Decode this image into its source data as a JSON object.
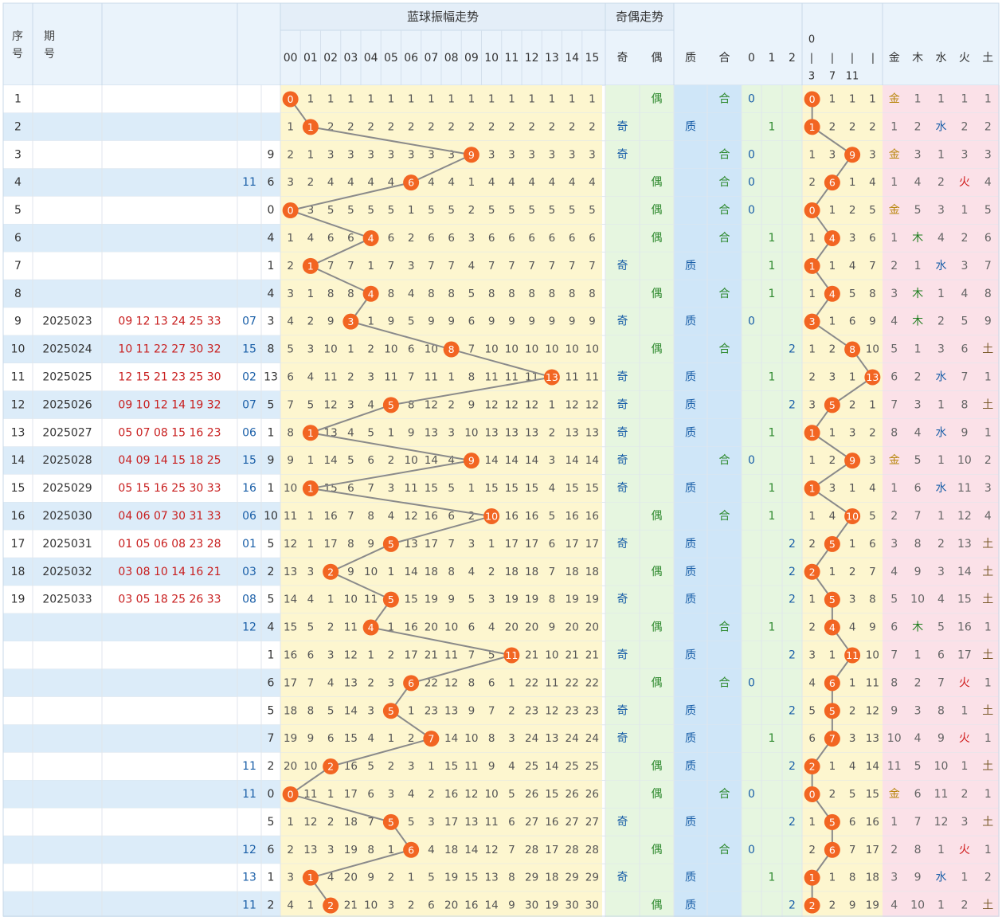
{
  "header": {
    "seq_label": "序号",
    "period_label": "期号",
    "amp_title": "蓝球振幅走势",
    "parity_title": "奇偶走势",
    "amp_cols": [
      "00",
      "01",
      "02",
      "03",
      "04",
      "05",
      "06",
      "07",
      "08",
      "09",
      "10",
      "11",
      "12",
      "13",
      "14",
      "15"
    ],
    "odd": "奇",
    "even": "偶",
    "prime": "质",
    "composite": "合",
    "r0": "0",
    "r1": "1",
    "r2": "2",
    "seg_0_3": "0|3",
    "seg_4_7": "|7",
    "seg_8_11": "|11",
    "seg_12_15": "|",
    "elements": [
      "金",
      "木",
      "水",
      "火",
      "土"
    ]
  },
  "rows": [
    {
      "seq": "1",
      "period": "",
      "reds": "",
      "blue": "",
      "val": "",
      "amp": 0,
      "amp_cells": [
        0,
        1,
        1,
        1,
        1,
        1,
        1,
        1,
        1,
        1,
        1,
        1,
        1,
        1,
        1,
        1
      ],
      "odd": "",
      "even": "偶",
      "prime": "",
      "comp": "合",
      "r0": "0",
      "r1": "",
      "r2": "",
      "seg": [
        "0",
        "1",
        "1",
        "1"
      ],
      "elem": [
        "金",
        "1",
        "1",
        "1",
        "1"
      ]
    },
    {
      "seq": "2",
      "period": "",
      "reds": "",
      "blue": "",
      "val": "",
      "amp": 1,
      "amp_cells": [
        1,
        1,
        2,
        2,
        2,
        2,
        2,
        2,
        2,
        2,
        2,
        2,
        2,
        2,
        2,
        2
      ],
      "odd": "奇",
      "even": "",
      "prime": "质",
      "comp": "",
      "r0": "",
      "r1": "1",
      "r2": "",
      "seg": [
        "1",
        "2",
        "2",
        "2"
      ],
      "elem": [
        "1",
        "2",
        "水",
        "2",
        "2"
      ]
    },
    {
      "seq": "3",
      "period": "",
      "reds": "",
      "blue": "",
      "val": "9",
      "amp": 9,
      "amp_cells": [
        2,
        1,
        3,
        3,
        3,
        3,
        3,
        3,
        3,
        9,
        3,
        3,
        3,
        3,
        3,
        3
      ],
      "odd": "奇",
      "even": "",
      "prime": "",
      "comp": "合",
      "r0": "0",
      "r1": "",
      "r2": "",
      "seg": [
        "1",
        "3",
        "9",
        "3"
      ],
      "elem": [
        "金",
        "3",
        "1",
        "3",
        "3"
      ]
    },
    {
      "seq": "4",
      "period": "",
      "reds": "",
      "blue": "11",
      "val": "6",
      "amp": 6,
      "amp_cells": [
        3,
        2,
        4,
        4,
        4,
        4,
        6,
        4,
        4,
        1,
        4,
        4,
        4,
        4,
        4,
        4
      ],
      "odd": "",
      "even": "偶",
      "prime": "",
      "comp": "合",
      "r0": "0",
      "r1": "",
      "r2": "",
      "seg": [
        "2",
        "6",
        "1",
        "4"
      ],
      "elem": [
        "1",
        "4",
        "2",
        "火",
        "4"
      ]
    },
    {
      "seq": "5",
      "period": "",
      "reds": "",
      "blue": "",
      "val": "0",
      "amp": 0,
      "amp_cells": [
        0,
        3,
        5,
        5,
        5,
        5,
        1,
        5,
        5,
        2,
        5,
        5,
        5,
        5,
        5,
        5
      ],
      "odd": "",
      "even": "偶",
      "prime": "",
      "comp": "合",
      "r0": "0",
      "r1": "",
      "r2": "",
      "seg": [
        "0",
        "1",
        "2",
        "5"
      ],
      "elem": [
        "金",
        "5",
        "3",
        "1",
        "5"
      ]
    },
    {
      "seq": "6",
      "period": "",
      "reds": "",
      "blue": "",
      "val": "4",
      "amp": 4,
      "amp_cells": [
        1,
        4,
        6,
        6,
        4,
        6,
        2,
        6,
        6,
        3,
        6,
        6,
        6,
        6,
        6,
        6
      ],
      "odd": "",
      "even": "偶",
      "prime": "",
      "comp": "合",
      "r0": "",
      "r1": "1",
      "r2": "",
      "seg": [
        "1",
        "4",
        "3",
        "6"
      ],
      "elem": [
        "1",
        "木",
        "4",
        "2",
        "6"
      ]
    },
    {
      "seq": "7",
      "period": "",
      "reds": "",
      "blue": "",
      "val": "1",
      "amp": 1,
      "amp_cells": [
        2,
        1,
        7,
        7,
        1,
        7,
        3,
        7,
        7,
        4,
        7,
        7,
        7,
        7,
        7,
        7
      ],
      "odd": "奇",
      "even": "",
      "prime": "质",
      "comp": "",
      "r0": "",
      "r1": "1",
      "r2": "",
      "seg": [
        "1",
        "1",
        "4",
        "7"
      ],
      "elem": [
        "2",
        "1",
        "水",
        "3",
        "7"
      ]
    },
    {
      "seq": "8",
      "period": "",
      "reds": "",
      "blue": "",
      "val": "4",
      "amp": 4,
      "amp_cells": [
        3,
        1,
        8,
        8,
        4,
        8,
        4,
        8,
        8,
        5,
        8,
        8,
        8,
        8,
        8,
        8
      ],
      "odd": "",
      "even": "偶",
      "prime": "",
      "comp": "合",
      "r0": "",
      "r1": "1",
      "r2": "",
      "seg": [
        "1",
        "4",
        "5",
        "8"
      ],
      "elem": [
        "3",
        "木",
        "1",
        "4",
        "8"
      ]
    },
    {
      "seq": "9",
      "period": "2025023",
      "reds": "09 12 13 24 25 33",
      "blue": "07",
      "val": "3",
      "amp": 3,
      "amp_cells": [
        4,
        2,
        9,
        3,
        1,
        9,
        5,
        9,
        9,
        6,
        9,
        9,
        9,
        9,
        9,
        9
      ],
      "odd": "奇",
      "even": "",
      "prime": "质",
      "comp": "",
      "r0": "0",
      "r1": "",
      "r2": "",
      "seg": [
        "3",
        "1",
        "6",
        "9"
      ],
      "elem": [
        "4",
        "木",
        "2",
        "5",
        "9"
      ]
    },
    {
      "seq": "10",
      "period": "2025024",
      "reds": "10 11 22 27 30 32",
      "blue": "15",
      "val": "8",
      "amp": 8,
      "amp_cells": [
        5,
        3,
        10,
        1,
        2,
        10,
        6,
        10,
        8,
        7,
        10,
        10,
        10,
        10,
        10,
        10
      ],
      "odd": "",
      "even": "偶",
      "prime": "",
      "comp": "合",
      "r0": "",
      "r1": "",
      "r2": "2",
      "seg": [
        "1",
        "2",
        "8",
        "10"
      ],
      "elem": [
        "5",
        "1",
        "3",
        "6",
        "土"
      ]
    },
    {
      "seq": "11",
      "period": "2025025",
      "reds": "12 15 21 23 25 30",
      "blue": "02",
      "val": "13",
      "amp": 13,
      "amp_cells": [
        6,
        4,
        11,
        2,
        3,
        11,
        7,
        11,
        1,
        8,
        11,
        11,
        11,
        13,
        11,
        11
      ],
      "odd": "奇",
      "even": "",
      "prime": "质",
      "comp": "",
      "r0": "",
      "r1": "1",
      "r2": "",
      "seg": [
        "2",
        "3",
        "1",
        "13"
      ],
      "elem": [
        "6",
        "2",
        "水",
        "7",
        "1"
      ]
    },
    {
      "seq": "12",
      "period": "2025026",
      "reds": "09 10 12 14 19 32",
      "blue": "07",
      "val": "5",
      "amp": 5,
      "amp_cells": [
        7,
        5,
        12,
        3,
        4,
        5,
        8,
        12,
        2,
        9,
        12,
        12,
        12,
        1,
        12,
        12
      ],
      "odd": "奇",
      "even": "",
      "prime": "质",
      "comp": "",
      "r0": "",
      "r1": "",
      "r2": "2",
      "seg": [
        "3",
        "5",
        "2",
        "1"
      ],
      "elem": [
        "7",
        "3",
        "1",
        "8",
        "土"
      ]
    },
    {
      "seq": "13",
      "period": "2025027",
      "reds": "05 07 08 15 16 23",
      "blue": "06",
      "val": "1",
      "amp": 1,
      "amp_cells": [
        8,
        1,
        13,
        4,
        5,
        1,
        9,
        13,
        3,
        10,
        13,
        13,
        13,
        2,
        13,
        13
      ],
      "odd": "奇",
      "even": "",
      "prime": "质",
      "comp": "",
      "r0": "",
      "r1": "1",
      "r2": "",
      "seg": [
        "1",
        "1",
        "3",
        "2"
      ],
      "elem": [
        "8",
        "4",
        "水",
        "9",
        "1"
      ]
    },
    {
      "seq": "14",
      "period": "2025028",
      "reds": "04 09 14 15 18 25",
      "blue": "15",
      "val": "9",
      "amp": 9,
      "amp_cells": [
        9,
        1,
        14,
        5,
        6,
        2,
        10,
        14,
        4,
        9,
        14,
        14,
        14,
        3,
        14,
        14
      ],
      "odd": "奇",
      "even": "",
      "prime": "",
      "comp": "合",
      "r0": "0",
      "r1": "",
      "r2": "",
      "seg": [
        "1",
        "2",
        "9",
        "3"
      ],
      "elem": [
        "金",
        "5",
        "1",
        "10",
        "2"
      ]
    },
    {
      "seq": "15",
      "period": "2025029",
      "reds": "05 15 16 25 30 33",
      "blue": "16",
      "val": "1",
      "amp": 1,
      "amp_cells": [
        10,
        1,
        15,
        6,
        7,
        3,
        11,
        15,
        5,
        1,
        15,
        15,
        15,
        4,
        15,
        15
      ],
      "odd": "奇",
      "even": "",
      "prime": "质",
      "comp": "",
      "r0": "",
      "r1": "1",
      "r2": "",
      "seg": [
        "1",
        "3",
        "1",
        "4"
      ],
      "elem": [
        "1",
        "6",
        "水",
        "11",
        "3"
      ]
    },
    {
      "seq": "16",
      "period": "2025030",
      "reds": "04 06 07 30 31 33",
      "blue": "06",
      "val": "10",
      "amp": 10,
      "amp_cells": [
        11,
        1,
        16,
        7,
        8,
        4,
        12,
        16,
        6,
        2,
        10,
        16,
        16,
        5,
        16,
        16
      ],
      "odd": "",
      "even": "偶",
      "prime": "",
      "comp": "合",
      "r0": "",
      "r1": "1",
      "r2": "",
      "seg": [
        "1",
        "4",
        "10",
        "5"
      ],
      "elem": [
        "2",
        "7",
        "1",
        "12",
        "4"
      ]
    },
    {
      "seq": "17",
      "period": "2025031",
      "reds": "01 05 06 08 23 28",
      "blue": "01",
      "val": "5",
      "amp": 5,
      "amp_cells": [
        12,
        1,
        17,
        8,
        9,
        5,
        13,
        17,
        7,
        3,
        1,
        17,
        17,
        6,
        17,
        17
      ],
      "odd": "奇",
      "even": "",
      "prime": "质",
      "comp": "",
      "r0": "",
      "r1": "",
      "r2": "2",
      "seg": [
        "2",
        "5",
        "1",
        "6"
      ],
      "elem": [
        "3",
        "8",
        "2",
        "13",
        "土"
      ]
    },
    {
      "seq": "18",
      "period": "2025032",
      "reds": "03 08 10 14 16 21",
      "blue": "03",
      "val": "2",
      "amp": 2,
      "amp_cells": [
        13,
        3,
        2,
        9,
        10,
        1,
        14,
        18,
        8,
        4,
        2,
        18,
        18,
        7,
        18,
        18
      ],
      "odd": "",
      "even": "偶",
      "prime": "质",
      "comp": "",
      "r0": "",
      "r1": "",
      "r2": "2",
      "seg": [
        "2",
        "1",
        "2",
        "7"
      ],
      "elem": [
        "4",
        "9",
        "3",
        "14",
        "土"
      ]
    },
    {
      "seq": "19",
      "period": "2025033",
      "reds": "03 05 18 25 26 33",
      "blue": "08",
      "val": "5",
      "amp": 5,
      "amp_cells": [
        14,
        4,
        1,
        10,
        11,
        5,
        15,
        19,
        9,
        5,
        3,
        19,
        19,
        8,
        19,
        19
      ],
      "odd": "奇",
      "even": "",
      "prime": "质",
      "comp": "",
      "r0": "",
      "r1": "",
      "r2": "2",
      "seg": [
        "1",
        "5",
        "3",
        "8"
      ],
      "elem": [
        "5",
        "10",
        "4",
        "15",
        "土"
      ]
    },
    {
      "seq": "",
      "period": "",
      "reds": "",
      "blue": "12",
      "val": "4",
      "amp": 4,
      "amp_cells": [
        15,
        5,
        2,
        11,
        4,
        1,
        16,
        20,
        10,
        6,
        4,
        20,
        20,
        9,
        20,
        20
      ],
      "odd": "",
      "even": "偶",
      "prime": "",
      "comp": "合",
      "r0": "",
      "r1": "1",
      "r2": "",
      "seg": [
        "2",
        "4",
        "4",
        "9"
      ],
      "elem": [
        "6",
        "木",
        "5",
        "16",
        "1"
      ]
    },
    {
      "seq": "",
      "period": "",
      "reds": "",
      "blue": "",
      "val": "1",
      "amp": 11,
      "amp_cells": [
        16,
        6,
        3,
        12,
        1,
        2,
        17,
        21,
        11,
        7,
        5,
        11,
        21,
        10,
        21,
        21
      ],
      "odd": "奇",
      "even": "",
      "prime": "质",
      "comp": "",
      "r0": "",
      "r1": "",
      "r2": "2",
      "seg": [
        "3",
        "1",
        "11",
        "10"
      ],
      "elem": [
        "7",
        "1",
        "6",
        "17",
        "土"
      ]
    },
    {
      "seq": "",
      "period": "",
      "reds": "",
      "blue": "",
      "val": "6",
      "amp": 6,
      "amp_cells": [
        17,
        7,
        4,
        13,
        2,
        3,
        6,
        22,
        12,
        8,
        6,
        1,
        22,
        11,
        22,
        22
      ],
      "odd": "",
      "even": "偶",
      "prime": "",
      "comp": "合",
      "r0": "0",
      "r1": "",
      "r2": "",
      "seg": [
        "4",
        "6",
        "1",
        "11"
      ],
      "elem": [
        "8",
        "2",
        "7",
        "火",
        "1"
      ]
    },
    {
      "seq": "",
      "period": "",
      "reds": "",
      "blue": "",
      "val": "5",
      "amp": 5,
      "amp_cells": [
        18,
        8,
        5,
        14,
        3,
        5,
        1,
        23,
        13,
        9,
        7,
        2,
        23,
        12,
        23,
        23
      ],
      "odd": "奇",
      "even": "",
      "prime": "质",
      "comp": "",
      "r0": "",
      "r1": "",
      "r2": "2",
      "seg": [
        "5",
        "5",
        "2",
        "12"
      ],
      "elem": [
        "9",
        "3",
        "8",
        "1",
        "土"
      ]
    },
    {
      "seq": "",
      "period": "",
      "reds": "",
      "blue": "",
      "val": "7",
      "amp": 7,
      "amp_cells": [
        19,
        9,
        6,
        15,
        4,
        1,
        2,
        7,
        14,
        10,
        8,
        3,
        24,
        13,
        24,
        24
      ],
      "odd": "奇",
      "even": "",
      "prime": "质",
      "comp": "",
      "r0": "",
      "r1": "1",
      "r2": "",
      "seg": [
        "6",
        "7",
        "3",
        "13"
      ],
      "elem": [
        "10",
        "4",
        "9",
        "火",
        "1"
      ]
    },
    {
      "seq": "",
      "period": "",
      "reds": "",
      "blue": "11",
      "val": "2",
      "amp": 2,
      "amp_cells": [
        20,
        10,
        2,
        16,
        5,
        2,
        3,
        1,
        15,
        11,
        9,
        4,
        25,
        14,
        25,
        25
      ],
      "odd": "",
      "even": "偶",
      "prime": "质",
      "comp": "",
      "r0": "",
      "r1": "",
      "r2": "2",
      "seg": [
        "2",
        "1",
        "4",
        "14"
      ],
      "elem": [
        "11",
        "5",
        "10",
        "1",
        "土"
      ]
    },
    {
      "seq": "",
      "period": "",
      "reds": "",
      "blue": "11",
      "val": "0",
      "amp": 0,
      "amp_cells": [
        0,
        11,
        1,
        17,
        6,
        3,
        4,
        2,
        16,
        12,
        10,
        5,
        26,
        15,
        26,
        26
      ],
      "odd": "",
      "even": "偶",
      "prime": "",
      "comp": "合",
      "r0": "0",
      "r1": "",
      "r2": "",
      "seg": [
        "0",
        "2",
        "5",
        "15"
      ],
      "elem": [
        "金",
        "6",
        "11",
        "2",
        "1"
      ]
    },
    {
      "seq": "",
      "period": "",
      "reds": "",
      "blue": "",
      "val": "5",
      "amp": 5,
      "amp_cells": [
        1,
        12,
        2,
        18,
        7,
        5,
        5,
        3,
        17,
        13,
        11,
        6,
        27,
        16,
        27,
        27
      ],
      "odd": "奇",
      "even": "",
      "prime": "质",
      "comp": "",
      "r0": "",
      "r1": "",
      "r2": "2",
      "seg": [
        "1",
        "5",
        "6",
        "16"
      ],
      "elem": [
        "1",
        "7",
        "12",
        "3",
        "土"
      ]
    },
    {
      "seq": "",
      "period": "",
      "reds": "",
      "blue": "12",
      "val": "6",
      "amp": 6,
      "amp_cells": [
        2,
        13,
        3,
        19,
        8,
        1,
        6,
        4,
        18,
        14,
        12,
        7,
        28,
        17,
        28,
        28
      ],
      "odd": "",
      "even": "偶",
      "prime": "",
      "comp": "合",
      "r0": "0",
      "r1": "",
      "r2": "",
      "seg": [
        "2",
        "6",
        "7",
        "17"
      ],
      "elem": [
        "2",
        "8",
        "1",
        "火",
        "1"
      ]
    },
    {
      "seq": "",
      "period": "",
      "reds": "",
      "blue": "13",
      "val": "1",
      "amp": 1,
      "amp_cells": [
        3,
        1,
        4,
        20,
        9,
        2,
        1,
        5,
        19,
        15,
        13,
        8,
        29,
        18,
        29,
        29
      ],
      "odd": "奇",
      "even": "",
      "prime": "质",
      "comp": "",
      "r0": "",
      "r1": "1",
      "r2": "",
      "seg": [
        "1",
        "1",
        "8",
        "18"
      ],
      "elem": [
        "3",
        "9",
        "水",
        "1",
        "2"
      ]
    },
    {
      "seq": "",
      "period": "",
      "reds": "",
      "blue": "11",
      "val": "2",
      "amp": 2,
      "amp_cells": [
        4,
        1,
        2,
        21,
        10,
        3,
        2,
        6,
        20,
        16,
        14,
        9,
        30,
        19,
        30,
        30
      ],
      "odd": "",
      "even": "偶",
      "prime": "质",
      "comp": "",
      "r0": "",
      "r1": "",
      "r2": "2",
      "seg": [
        "2",
        "2",
        "9",
        "19"
      ],
      "elem": [
        "4",
        "10",
        "1",
        "2",
        "土"
      ]
    }
  ],
  "colors": {
    "ball": "#f26522",
    "line": "#8a8a8a",
    "amp_bg": "#fdf6cf",
    "green_bg": "#e6f6e0",
    "blue_bg": "#cfe6f8",
    "pink_bg": "#fbe1e8",
    "header_bg": "#eaf3fb",
    "red_text": "#c81e1e",
    "blue_text": "#1a5fa8"
  }
}
